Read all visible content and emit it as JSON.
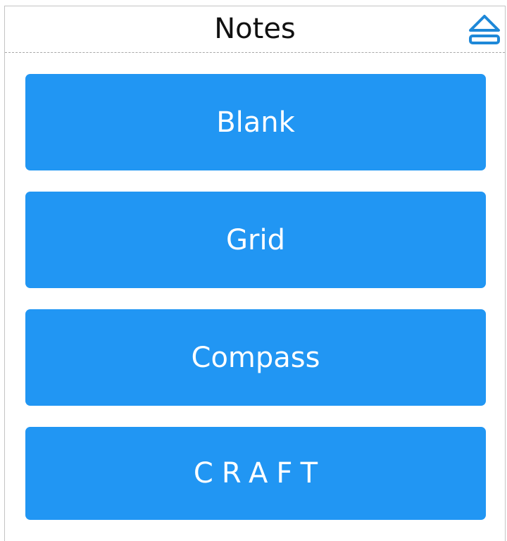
{
  "header": {
    "title": "Notes",
    "eject_icon": "eject-icon"
  },
  "buttons": [
    {
      "label": "Blank"
    },
    {
      "label": "Grid"
    },
    {
      "label": "Compass"
    },
    {
      "label": "CRAFT"
    }
  ],
  "colors": {
    "accent": "#2196f3",
    "icon": "#1e88d8",
    "text_on_accent": "#ffffff"
  }
}
